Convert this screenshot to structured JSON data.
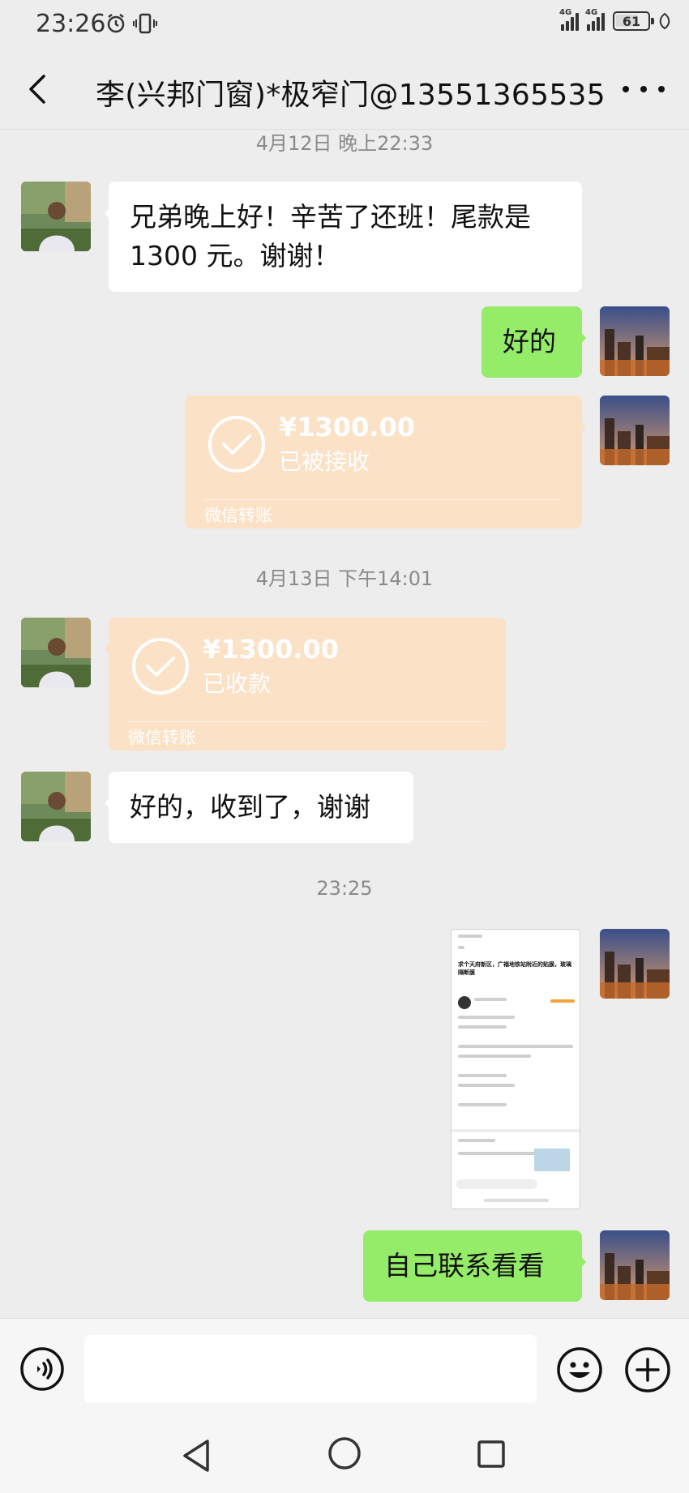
{
  "status_bar": {
    "time": "23:26",
    "network_1": "4G",
    "network_2": "4G",
    "battery": "61"
  },
  "header": {
    "title": "李(兴邦门窗)*极窄门@13551365535",
    "back_icon": "chevron-left-icon",
    "more_icon": "more-dots-icon"
  },
  "timestamps": [
    "4月12日 晚上22:33",
    "4月13日 下午14:01",
    "23:25"
  ],
  "messages": {
    "m1": "兄弟晚上好！辛苦了还班！尾款是1300 元。谢谢！",
    "m2": "好的",
    "m3_amount": "¥1300.00",
    "m3_status": "已被接收",
    "m3_footer": "微信转账",
    "m4_amount": "¥1300.00",
    "m4_status": "已收款",
    "m4_footer": "微信转账",
    "m5": "好的，收到了，谢谢",
    "m7": "自己联系看看"
  },
  "image_message": {
    "title": "求个天府新区，广福地铁站附近的贴膜，玻璃隔断膜"
  },
  "input_bar": {
    "voice_icon": "voice-icon",
    "emoji_icon": "emoji-icon",
    "plus_icon": "plus-icon"
  },
  "colors": {
    "background": "#ededed",
    "outgoing_bubble": "#95ec69",
    "incoming_bubble": "#ffffff",
    "transfer_card": "#fbe1c6"
  }
}
